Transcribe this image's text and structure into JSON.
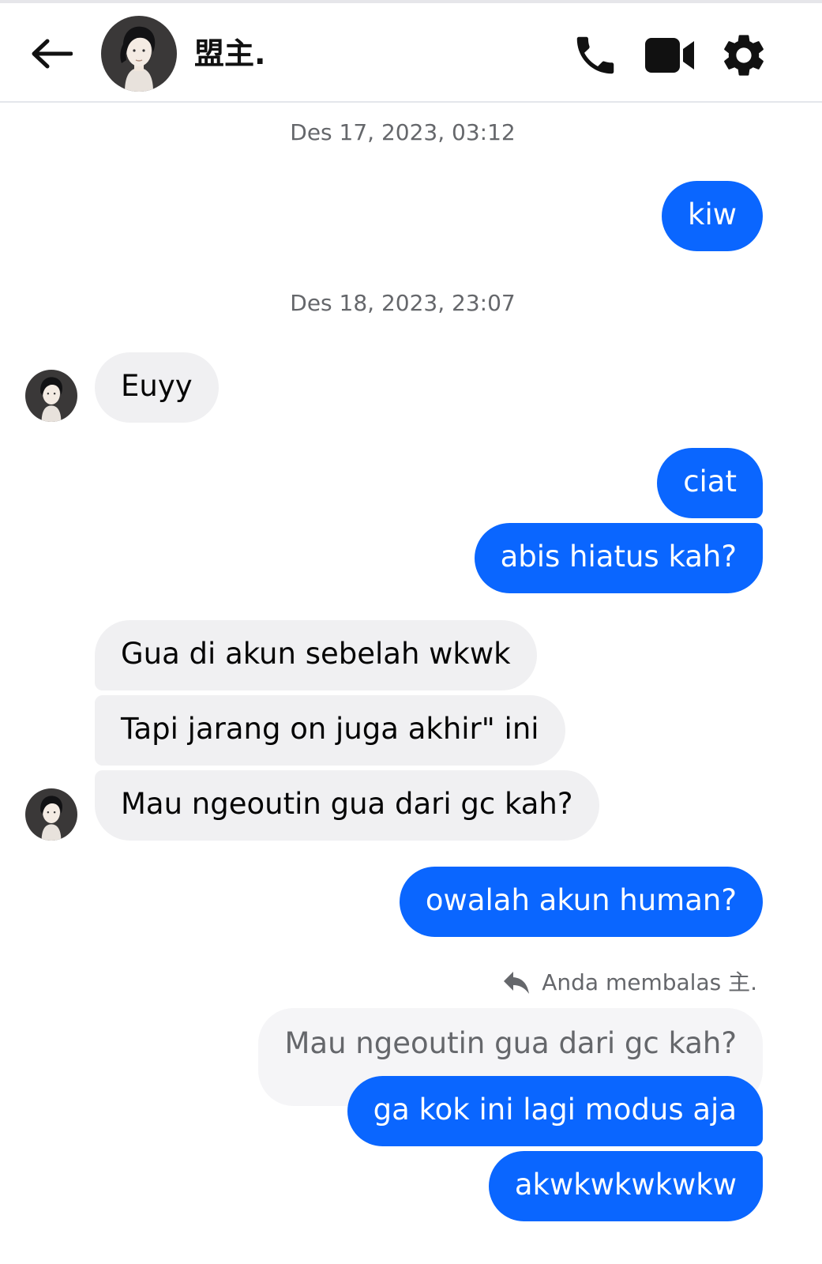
{
  "header": {
    "contact_name": "盟主.",
    "icons": {
      "back": "arrow-left-icon",
      "call": "phone-icon",
      "video": "video-camera-icon",
      "settings": "gear-icon"
    }
  },
  "colors": {
    "outgoing_bubble": "#0a66ff",
    "incoming_bubble": "#f0f0f2",
    "timestamp_text": "#65676b"
  },
  "timestamps": [
    "Des 17, 2023, 03:12",
    "Des 18, 2023, 23:07"
  ],
  "messages": [
    {
      "direction": "out",
      "text": "kiw"
    },
    {
      "direction": "in",
      "text": "Euyy"
    },
    {
      "direction": "out",
      "text": "ciat"
    },
    {
      "direction": "out",
      "text": "abis hiatus kah?"
    },
    {
      "direction": "in",
      "text": "Gua di akun sebelah wkwk"
    },
    {
      "direction": "in",
      "text": "Tapi jarang on juga akhir\" ini"
    },
    {
      "direction": "in",
      "text": "Mau ngeoutin gua dari gc kah?"
    },
    {
      "direction": "out",
      "text": "owalah akun human?"
    },
    {
      "direction": "out",
      "text": "ga kok ini lagi modus aja"
    },
    {
      "direction": "out",
      "text": "akwkwkwkwkw"
    }
  ],
  "reply": {
    "note": "Anda membalas 主.",
    "quoted_text": "Mau ngeoutin gua dari gc kah?",
    "icon": "reply-arrow-icon"
  }
}
